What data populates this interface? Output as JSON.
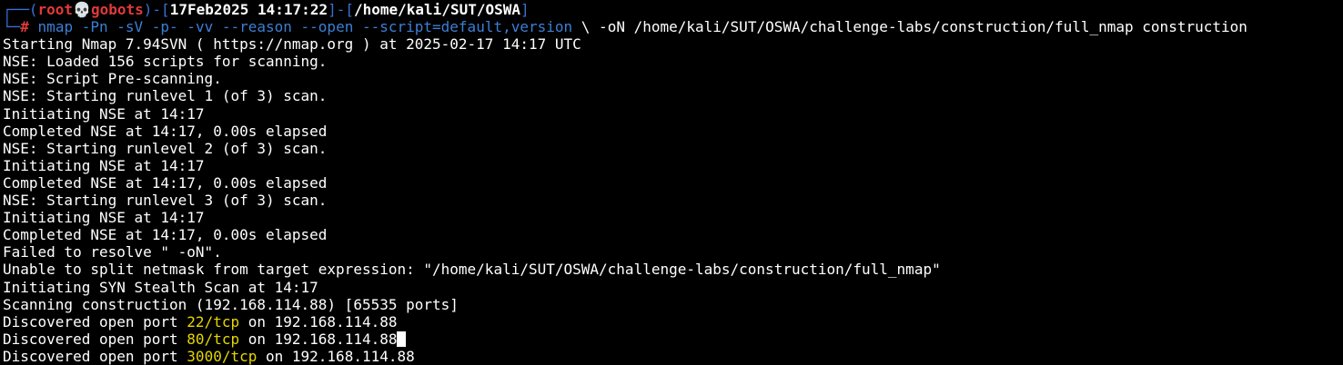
{
  "prompt": {
    "user": "root",
    "skull": "💀",
    "host": "gobots",
    "date": "17Feb2025 14:17:22",
    "path": "/home/kali/SUT/OSWA",
    "symbol": "#"
  },
  "command": {
    "colored": "nmap -Pn -sV -p- -vv --reason --open --script=default,version",
    "rest": " \\ -oN /home/kali/SUT/OSWA/challenge-labs/construction/full_nmap construction"
  },
  "output": [
    "Starting Nmap 7.94SVN ( https://nmap.org ) at 2025-02-17 14:17 UTC",
    "NSE: Loaded 156 scripts for scanning.",
    "NSE: Script Pre-scanning.",
    "NSE: Starting runlevel 1 (of 3) scan.",
    "Initiating NSE at 14:17",
    "Completed NSE at 14:17, 0.00s elapsed",
    "NSE: Starting runlevel 2 (of 3) scan.",
    "Initiating NSE at 14:17",
    "Completed NSE at 14:17, 0.00s elapsed",
    "NSE: Starting runlevel 3 (of 3) scan.",
    "Initiating NSE at 14:17",
    "Completed NSE at 14:17, 0.00s elapsed",
    "Failed to resolve \" -oN\".",
    "Unable to split netmask from target expression: \"/home/kali/SUT/OSWA/challenge-labs/construction/full_nmap\"",
    "Initiating SYN Stealth Scan at 14:17",
    "Scanning construction (192.168.114.88) [65535 ports]"
  ],
  "ports": [
    {
      "prefix": "Discovered open port ",
      "port": "22/tcp",
      "suffix": " on 192.168.114.88"
    },
    {
      "prefix": "Discovered open port ",
      "port": "80/tcp",
      "suffix": " on 192.168.114.88"
    },
    {
      "prefix": "Discovered open port ",
      "port": "3000/tcp",
      "suffix": " on 192.168.114.88"
    }
  ],
  "colors": {
    "background": "#000000",
    "prompt_frame": "#3b6fd6",
    "prompt_user": "#e03a3a",
    "command": "#3b7fd6",
    "port": "#e6d600"
  }
}
